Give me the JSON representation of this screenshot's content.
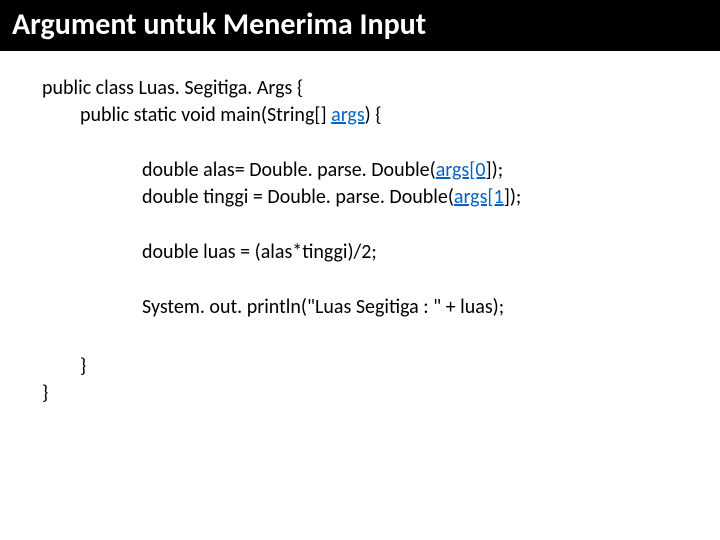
{
  "header": {
    "title": "Argument untuk Menerima Input"
  },
  "code": {
    "l1a": "public class Luas. Segitiga. Args {",
    "l2a": "public static void main(String[] ",
    "l2b": "args",
    "l2c": ") {",
    "l3a": "double alas= Double. parse. Double(",
    "l3b": "args[0",
    "l3c": "]);",
    "l4a": "double tinggi = Double. parse. Double(",
    "l4b": "args[1",
    "l4c": "]);",
    "l5": "double luas = (alas*tinggi)/2;",
    "l6": "System. out. println(\"Luas Segitiga : \" + luas);",
    "close1": "}",
    "close2": "}"
  }
}
